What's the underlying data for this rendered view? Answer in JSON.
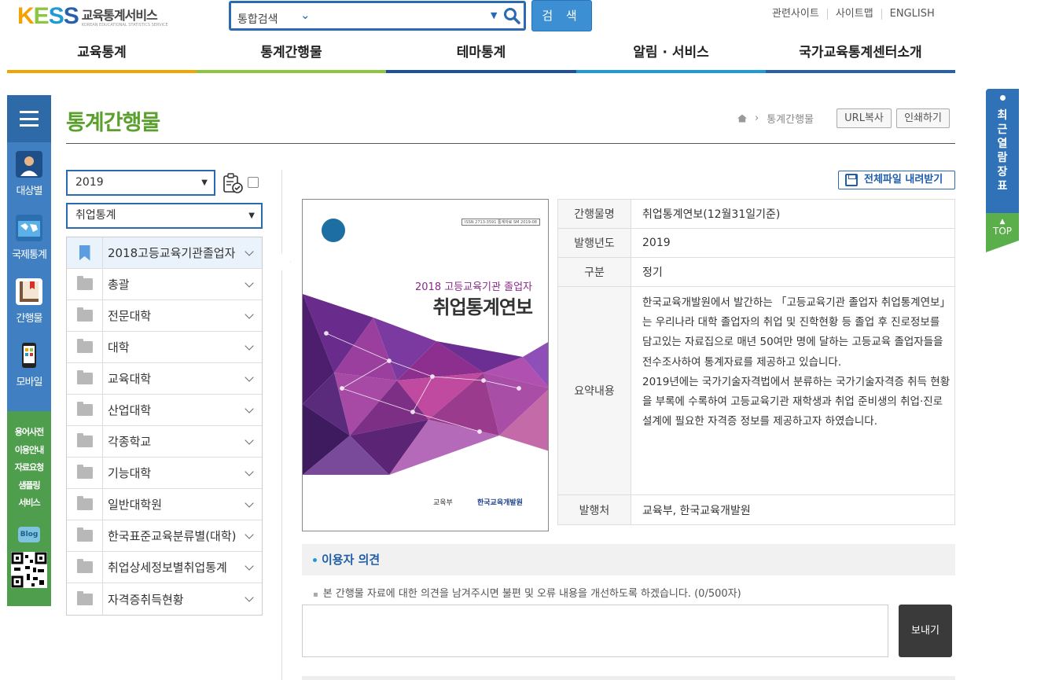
{
  "header": {
    "logo_mark": "KESS",
    "logo_name": "교육통계서비스",
    "logo_en": "KOREAN EDUCATIONAL STATISTICS SERVICE",
    "search_scope": "통합검색",
    "search_value": "",
    "search_button": "검 색",
    "links": [
      "관련사이트",
      "사이트맵",
      "ENGLISH"
    ]
  },
  "gnb": [
    {
      "label": "교육통계",
      "color": "#f0a500"
    },
    {
      "label": "통계간행물",
      "color": "#8cc63f"
    },
    {
      "label": "테마통계",
      "color": "#1f4f9c"
    },
    {
      "label": "알림 · 서비스",
      "color": "#1e9ad6"
    },
    {
      "label": "국가교육통계센터소개",
      "color": "#2a5fac"
    }
  ],
  "quick_left": {
    "items": [
      "대상별",
      "국제통계",
      "간행물",
      "모바일"
    ],
    "links": [
      "용어사전",
      "이용안내",
      "자료요청",
      "샘플링",
      "서비스"
    ],
    "blog": "Blog"
  },
  "quick_right": {
    "recent": "최근열람장표",
    "top": "TOP"
  },
  "page": {
    "title": "통계간행물",
    "breadcrumb": "통계간행물",
    "url_copy": "URL복사",
    "print": "인쇄하기"
  },
  "filters": {
    "year": "2019",
    "category": "취업통계"
  },
  "tree": [
    "2018고등교육기관졸업자",
    "총괄",
    "전문대학",
    "대학",
    "교육대학",
    "산업대학",
    "각종학교",
    "기능대학",
    "일반대학원",
    "한국표준교육분류별(대학)",
    "취업상세정보별취업통계",
    "자격증취득현황"
  ],
  "download": "전체파일 내려받기",
  "cover": {
    "issn": "ISSN 2713-3591 통계자료 SM 2019-08",
    "subtitle": "2018 고등교육기관 졸업자",
    "title": "취업통계연보",
    "publisher1": "교육부",
    "publisher2": "한국교육개발원"
  },
  "info": {
    "rows": [
      {
        "k": "간행물명",
        "v": "취업통계연보(12월31일기준)"
      },
      {
        "k": "발행년도",
        "v": "2019"
      },
      {
        "k": "구분",
        "v": "정기"
      },
      {
        "k": "요약내용",
        "v": "한국교육개발원에서 발간하는 「고등교육기관 졸업자 취업통계연보」는 우리나라 대학 졸업자의 취업 및 진학현황 등 졸업 후 진로정보를 담고있는 자료집으로 매년 50여만 명에 달하는 고등교육 졸업자들을 전수조사하여 통계자료를 제공하고 있습니다.\n2019년에는 국가기술자격법에서 분류하는 국가기술자격증 취득 현황을 부록에 수록하여 고등교육기관 재학생과 취업 준비생의 취업·진로 설계에 필요한 자격증 정보를 제공하고자 하였습니다."
      },
      {
        "k": "발행처",
        "v": "교육부, 한국교육개발원"
      }
    ]
  },
  "opinion": {
    "title": "이용자 의견",
    "note": "본 간행물 자료에 대한 의견을 남겨주시면 불편 및 오류 내용을 개선하도록 하겠습니다. (0/500자)",
    "text": "",
    "send": "보내기"
  }
}
